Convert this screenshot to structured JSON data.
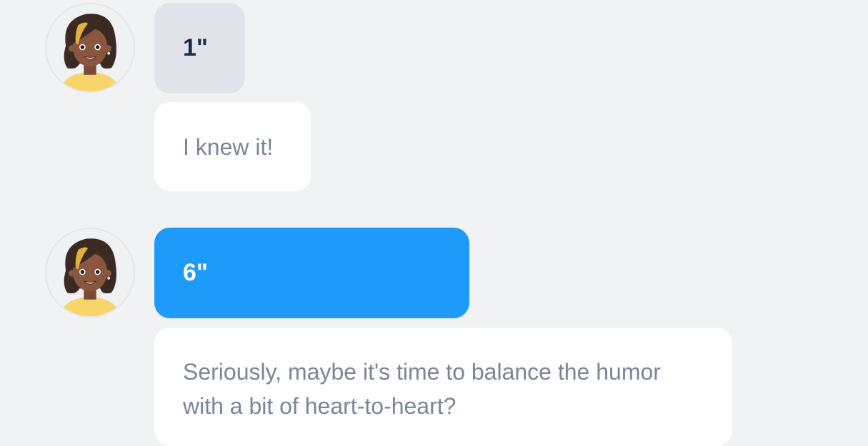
{
  "messages": [
    {
      "avatar_icon": "girl-avatar-icon",
      "answer": "1\"",
      "answer_state": "neutral",
      "reply": "I knew it!"
    },
    {
      "avatar_icon": "girl-avatar-icon",
      "answer": "6\"",
      "answer_state": "selected",
      "reply": "Seriously, maybe it's time to balance the humor with a bit of heart-to-heart?"
    }
  ],
  "colors": {
    "background": "#f1f2f4",
    "neutral_bubble": "#e1e5eb",
    "selected_bubble": "#1e9bfa",
    "reply_bubble": "#ffffff",
    "reply_text": "#7a8598"
  }
}
